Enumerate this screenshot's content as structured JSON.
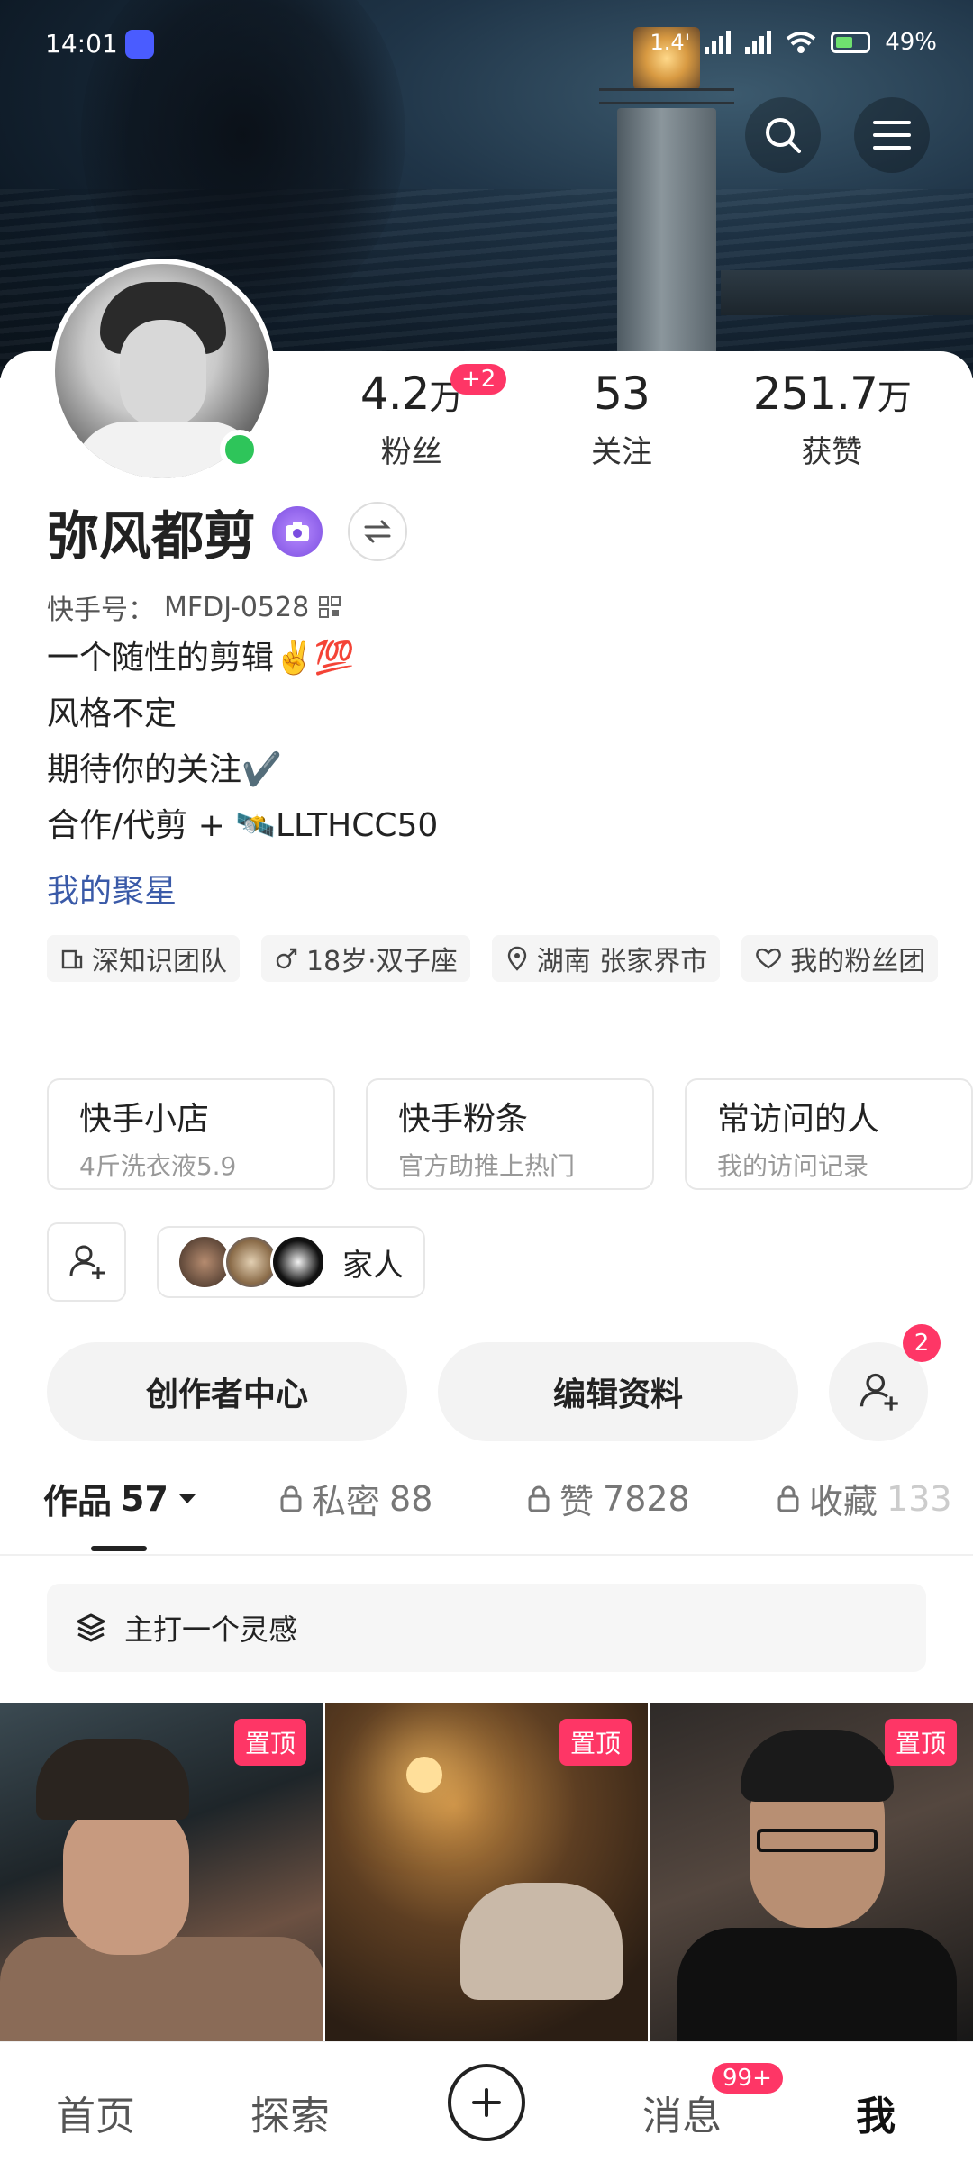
{
  "status_bar": {
    "time": "14:01",
    "network_speed": "1.4'",
    "battery": "49%"
  },
  "profile": {
    "name": "弥风都剪",
    "kuaishou_id_label": "快手号：",
    "kuaishou_id": "MFDJ-0528",
    "bio_lines": [
      "一个随性的剪辑✌️💯",
      "风格不定",
      "期待你的关注✔️",
      "合作/代剪 + 🛰️LLTHCC50"
    ],
    "juxing_link": "我的聚星"
  },
  "stats": {
    "fans": {
      "value": "4.2",
      "unit": "万",
      "badge": "+2",
      "label": "粉丝"
    },
    "following": {
      "value": "53",
      "label": "关注"
    },
    "likes": {
      "value": "251.7",
      "unit": "万",
      "label": "获赞"
    }
  },
  "tags": [
    {
      "icon": "team-icon",
      "label": "深知识团队"
    },
    {
      "icon": "male-icon",
      "label": "18岁·双子座"
    },
    {
      "icon": "location-icon",
      "label": "湖南 张家界市"
    },
    {
      "icon": "heart-icon",
      "label": "我的粉丝团"
    }
  ],
  "shortcuts": [
    {
      "title": "快手小店",
      "subtitle": "4斤洗衣液5.9"
    },
    {
      "title": "快手粉条",
      "subtitle": "官方助推上热门"
    },
    {
      "title": "常访问的人",
      "subtitle": "我的访问记录"
    }
  ],
  "family": {
    "label": "家人"
  },
  "actions": {
    "creator_center": "创作者中心",
    "edit_profile": "编辑资料",
    "friend_badge": "2"
  },
  "tabs": [
    {
      "label": "作品",
      "count": "57",
      "locked": false
    },
    {
      "label": "私密",
      "count": "88",
      "locked": true
    },
    {
      "label": "赞",
      "count": "7828",
      "locked": true
    },
    {
      "label": "收藏",
      "count": "133",
      "locked": true
    }
  ],
  "collection": {
    "label": "主打一个灵感"
  },
  "grid": {
    "pin_label": "置顶"
  },
  "bottom_nav": {
    "home": "首页",
    "explore": "探索",
    "messages": "消息",
    "messages_badge": "99+",
    "me": "我"
  },
  "colors": {
    "accent": "#fe3666",
    "online": "#2ec55a",
    "link": "#3a5aa8"
  }
}
